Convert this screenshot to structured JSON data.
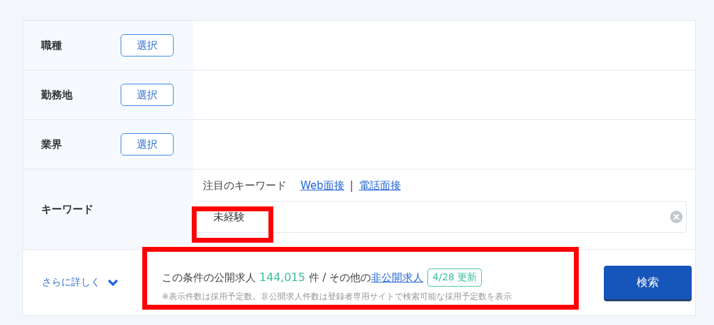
{
  "rows": [
    {
      "label": "職種",
      "button": "選択"
    },
    {
      "label": "勤務地",
      "button": "選択"
    },
    {
      "label": "業界",
      "button": "選択"
    }
  ],
  "keyword": {
    "label": "キーワード",
    "featured_caption": "注目のキーワード",
    "featured": [
      "Web面接",
      "電話面接"
    ],
    "separator": "|",
    "value": "未経験",
    "highlighted": true
  },
  "footer": {
    "more_link": "さらに詳しく",
    "summary": {
      "prefix": "この条件の公開求人",
      "count": "144,015",
      "unit": "件 / その他の",
      "link": "非公開求人",
      "badge": "4/28 更新",
      "note": "※表示件数は採用予定数。非公開求人件数は登録者専用サイトで検索可能な採用予定数を表示",
      "highlighted": true
    },
    "search_button": "検索"
  }
}
